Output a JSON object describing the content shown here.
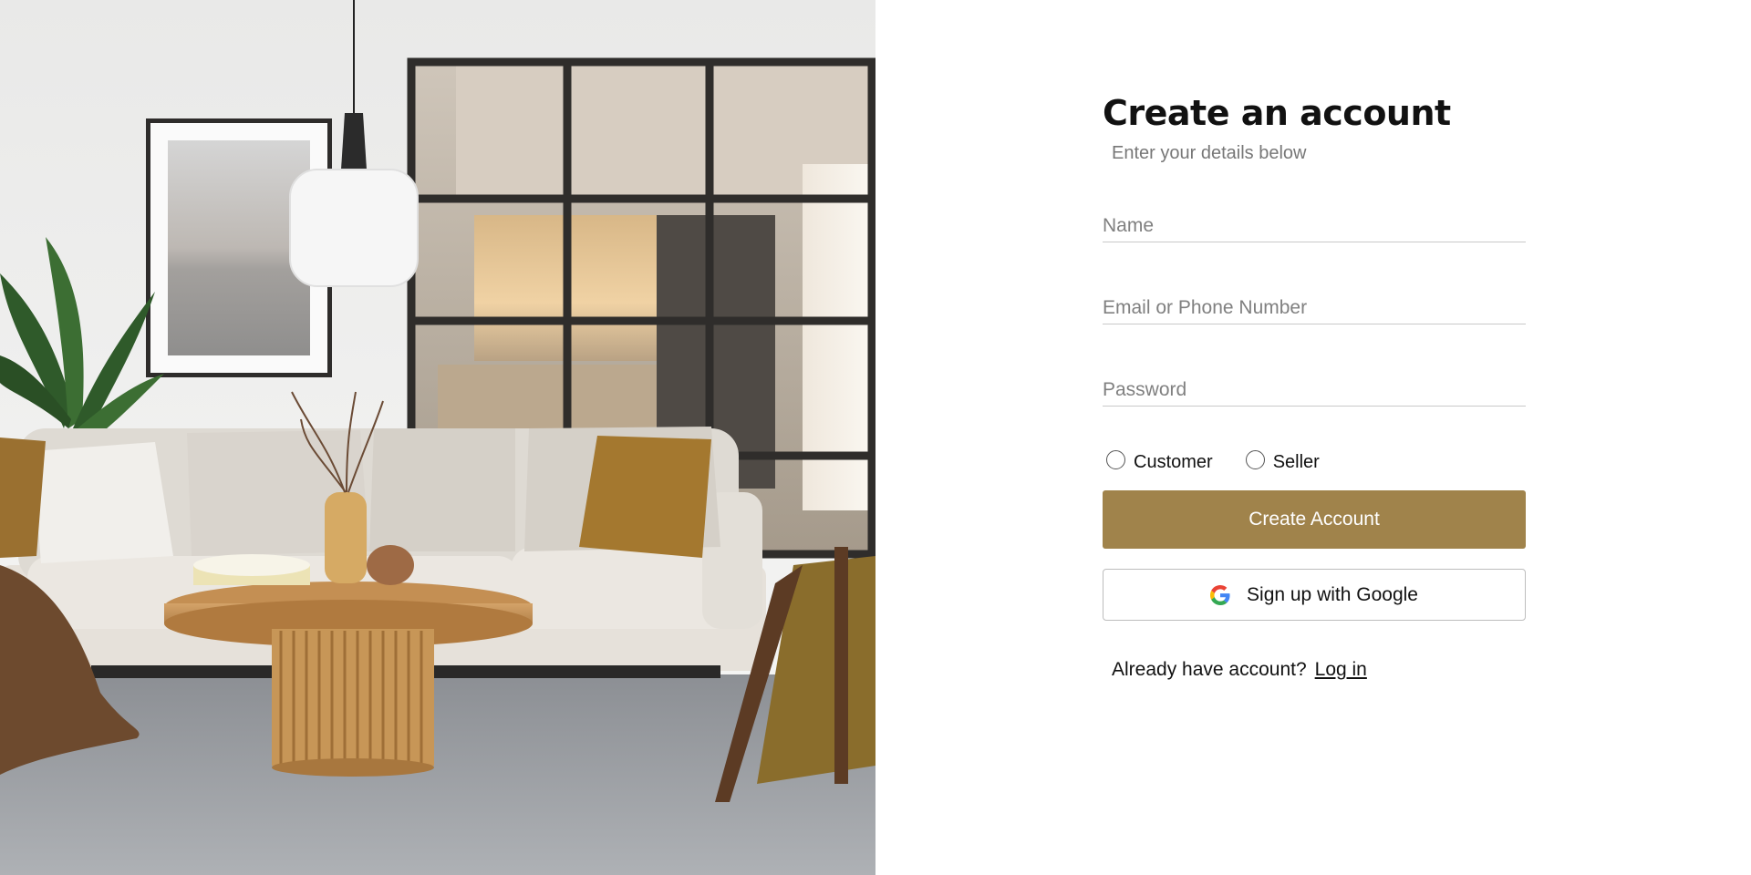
{
  "hero": {
    "image_alt": "Living room interior"
  },
  "form": {
    "title": "Create an account",
    "subtitle": "Enter your details below",
    "fields": {
      "name_placeholder": "Name",
      "email_placeholder": "Email or Phone Number",
      "password_placeholder": "Password"
    },
    "roles": [
      {
        "label": "Customer",
        "selected": false
      },
      {
        "label": "Seller",
        "selected": false
      }
    ],
    "create_button": "Create Account",
    "google_button": "Sign up with Google",
    "login_prompt": "Already have account?",
    "login_link": "Log in"
  },
  "colors": {
    "accent": "#a0834b",
    "text": "#111111",
    "muted": "#777777",
    "divider": "#c9c9c9"
  },
  "icons": {
    "google": "google-g-icon"
  }
}
